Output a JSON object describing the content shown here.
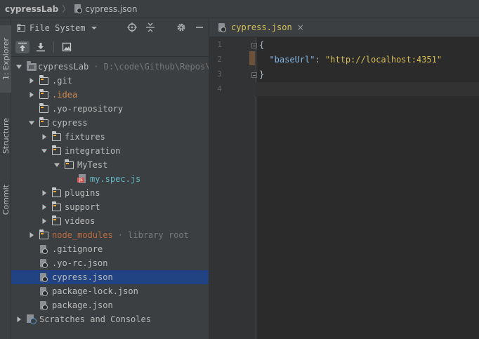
{
  "titlebar": {
    "project": "cypressLab",
    "file": "cypress.json"
  },
  "rail": {
    "tabs": [
      {
        "label": "1: Explorer"
      },
      {
        "label": "Structure"
      },
      {
        "label": "Commit"
      }
    ]
  },
  "panel": {
    "title": "File System",
    "tree": [
      {
        "label": "cypressLab",
        "hint": "· D:\\code\\Github\\Repos\\cypressLab",
        "indent": 0,
        "expanded": true,
        "type": "project"
      },
      {
        "label": ".git",
        "indent": 1,
        "expanded": false,
        "type": "folder"
      },
      {
        "label": ".idea",
        "indent": 1,
        "expanded": false,
        "type": "folder",
        "style": "ignored"
      },
      {
        "label": ".yo-repository",
        "indent": 1,
        "type": "folder"
      },
      {
        "label": "cypress",
        "indent": 1,
        "expanded": true,
        "type": "folder"
      },
      {
        "label": "fixtures",
        "indent": 2,
        "expanded": false,
        "type": "folder"
      },
      {
        "label": "integration",
        "indent": 2,
        "expanded": true,
        "type": "folder"
      },
      {
        "label": "MyTest",
        "indent": 3,
        "expanded": true,
        "type": "folder"
      },
      {
        "label": "my.spec.js",
        "indent": 4,
        "type": "js",
        "style": "spec"
      },
      {
        "label": "plugins",
        "indent": 2,
        "expanded": false,
        "type": "folder"
      },
      {
        "label": "support",
        "indent": 2,
        "expanded": false,
        "type": "folder"
      },
      {
        "label": "videos",
        "indent": 2,
        "expanded": false,
        "type": "folder"
      },
      {
        "label": "node_modules",
        "hint": "· library root",
        "indent": 1,
        "expanded": false,
        "type": "folder",
        "style": "excluded"
      },
      {
        "label": ".gitignore",
        "indent": 1,
        "type": "file"
      },
      {
        "label": ".yo-rc.json",
        "indent": 1,
        "type": "file"
      },
      {
        "label": "cypress.json",
        "indent": 1,
        "type": "file",
        "selected": true
      },
      {
        "label": "package-lock.json",
        "indent": 1,
        "type": "file"
      },
      {
        "label": "package.json",
        "indent": 1,
        "type": "file"
      },
      {
        "label": "Scratches and Consoles",
        "indent": 0,
        "expanded": false,
        "type": "scratch"
      }
    ]
  },
  "editor": {
    "tab": {
      "name": "cypress.json",
      "close": "×"
    },
    "lines": [
      {
        "num": "1",
        "text": "{"
      },
      {
        "num": "2",
        "key": "\"baseUrl\"",
        "colon": ": ",
        "value": "\"http://localhost:4351\""
      },
      {
        "num": "3",
        "text": "}"
      },
      {
        "num": "4",
        "text": ""
      }
    ]
  }
}
